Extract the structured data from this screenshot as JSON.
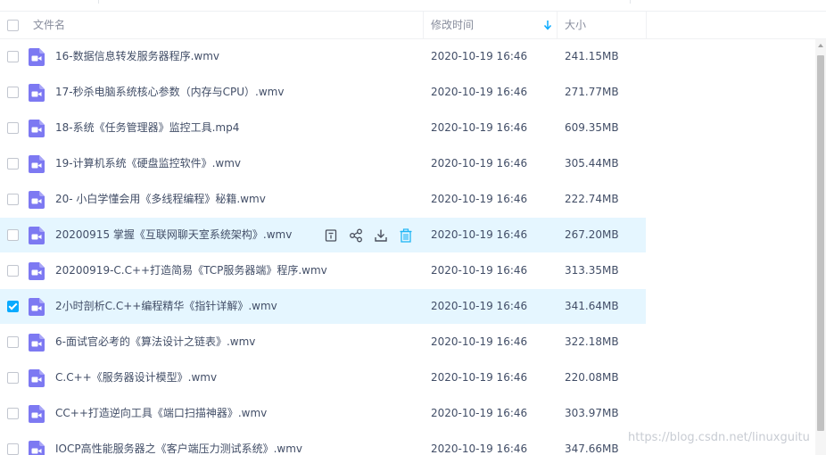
{
  "header": {
    "name_label": "文件名",
    "modified_label": "修改时间",
    "size_label": "大小"
  },
  "files": [
    {
      "name": "16-数据信息转发服务器程序.wmv",
      "modified": "2020-10-19 16:46",
      "size": "241.15MB",
      "checked": false,
      "hovered": false
    },
    {
      "name": "17-秒杀电脑系统核心参数（内存与CPU）.wmv",
      "modified": "2020-10-19 16:46",
      "size": "271.77MB",
      "checked": false,
      "hovered": false
    },
    {
      "name": "18-系统《任务管理器》监控工具.mp4",
      "modified": "2020-10-19 16:46",
      "size": "609.35MB",
      "checked": false,
      "hovered": false
    },
    {
      "name": "19-计算机系统《硬盘监控软件》.wmv",
      "modified": "2020-10-19 16:46",
      "size": "305.44MB",
      "checked": false,
      "hovered": false
    },
    {
      "name": "20- 小白学懂会用《多线程编程》秘籍.wmv",
      "modified": "2020-10-19 16:46",
      "size": "222.74MB",
      "checked": false,
      "hovered": false
    },
    {
      "name": "20200915 掌握《互联网聊天室系统架构》.wmv",
      "modified": "2020-10-19 16:46",
      "size": "267.20MB",
      "checked": false,
      "hovered": true
    },
    {
      "name": "20200919-C.C++打造简易《TCP服务器端》程序.wmv",
      "modified": "2020-10-19 16:46",
      "size": "313.35MB",
      "checked": false,
      "hovered": false
    },
    {
      "name": "2小时剖析C.C++编程精华《指针详解》.wmv",
      "modified": "2020-10-19 16:46",
      "size": "341.64MB",
      "checked": true,
      "hovered": false
    },
    {
      "name": "6-面试官必考的《算法设计之链表》.wmv",
      "modified": "2020-10-19 16:46",
      "size": "322.18MB",
      "checked": false,
      "hovered": false
    },
    {
      "name": "C.C++《服务器设计模型》.wmv",
      "modified": "2020-10-19 16:46",
      "size": "220.08MB",
      "checked": false,
      "hovered": false
    },
    {
      "name": "CC++打造逆向工具《端口扫描神器》.wmv",
      "modified": "2020-10-19 16:46",
      "size": "303.97MB",
      "checked": false,
      "hovered": false
    },
    {
      "name": "IOCP高性能服务器之《客户端压力测试系统》.wmv",
      "modified": "2020-10-19 16:46",
      "size": "347.66MB",
      "checked": false,
      "hovered": false
    }
  ],
  "row_actions": [
    "share-link-icon",
    "share-icon",
    "download-icon",
    "delete-icon"
  ],
  "watermark": "https://blog.csdn.net/linuxguitu",
  "colors": {
    "accent": "#09aaff",
    "row_highlight": "#e5f6ff",
    "video_icon": "#7d79f2",
    "delete_icon": "#1fb5f5"
  }
}
